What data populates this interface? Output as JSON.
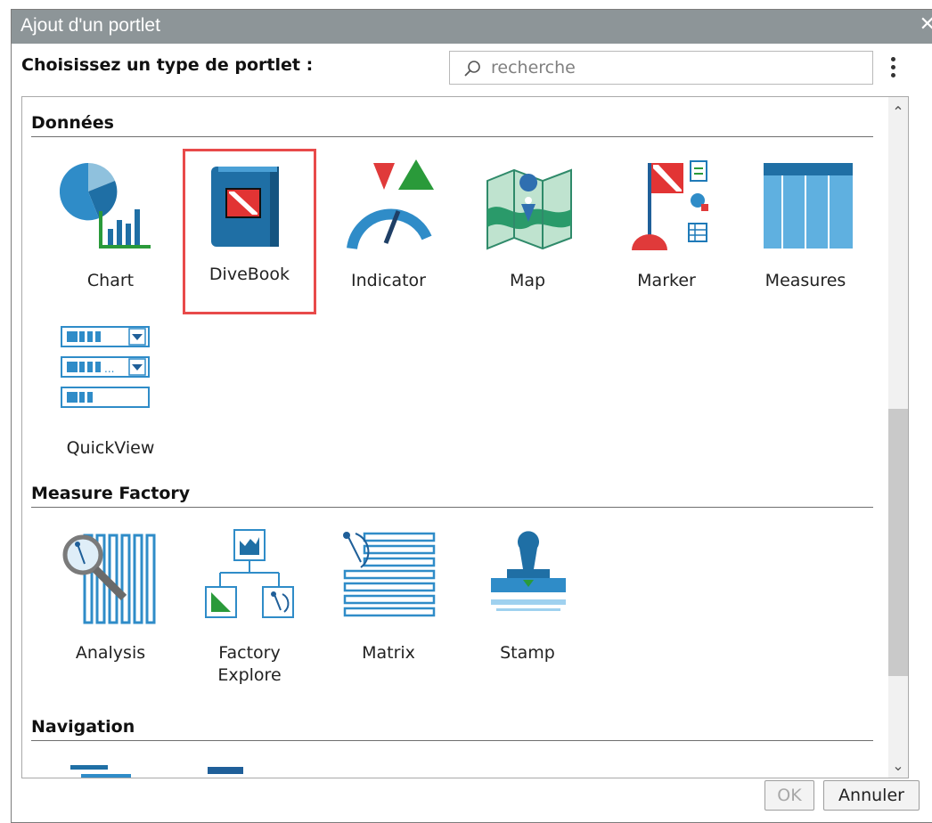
{
  "dialog": {
    "title": "Ajout d'un portlet",
    "close_glyph": "✕"
  },
  "prompt": "Choisissez un type de portlet :",
  "search": {
    "placeholder": "recherche",
    "value": ""
  },
  "sections": [
    {
      "header": "Données",
      "items": [
        {
          "label": "Chart",
          "icon": "chart-icon"
        },
        {
          "label": "DiveBook",
          "icon": "divebook-icon",
          "selected": true
        },
        {
          "label": "Indicator",
          "icon": "indicator-icon"
        },
        {
          "label": "Map",
          "icon": "map-icon"
        },
        {
          "label": "Marker",
          "icon": "marker-icon"
        },
        {
          "label": "Measures",
          "icon": "measures-icon"
        },
        {
          "label": "QuickView",
          "icon": "quickview-icon"
        }
      ]
    },
    {
      "header": "Measure Factory",
      "items": [
        {
          "label": "Analysis",
          "icon": "analysis-icon"
        },
        {
          "label": "Factory\nExplore",
          "icon": "factory-explore-icon"
        },
        {
          "label": "Matrix",
          "icon": "matrix-icon"
        },
        {
          "label": "Stamp",
          "icon": "stamp-icon"
        }
      ]
    },
    {
      "header": "Navigation",
      "items": []
    }
  ],
  "buttons": {
    "ok": "OK",
    "cancel": "Annuler"
  },
  "colors": {
    "titlebar": "#8d9598",
    "accent_blue": "#1f7ab8",
    "selection_border": "#e84a4a",
    "green": "#2a9a3a",
    "red": "#e03a3a"
  }
}
